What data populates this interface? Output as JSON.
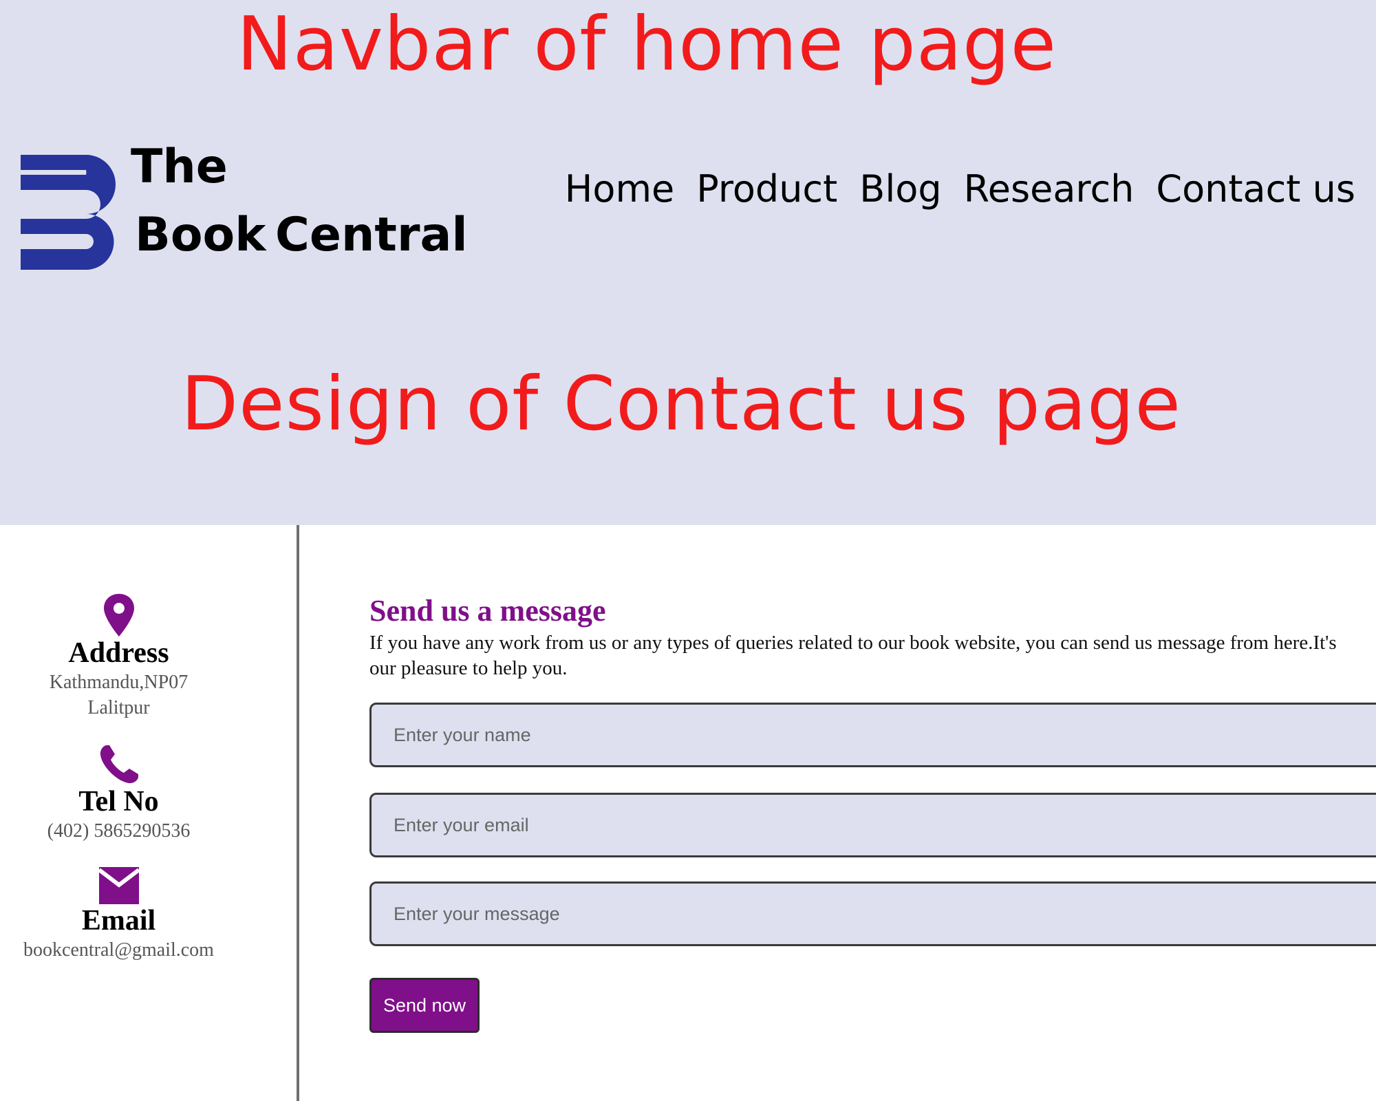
{
  "annotations": {
    "navbar_caption": "Navbar of home page",
    "contact_caption": "Design of Contact us page"
  },
  "brand": {
    "word_the": "The",
    "word_book": "Book",
    "word_central": "Central",
    "logo_color": "#26349b"
  },
  "nav": {
    "items": [
      {
        "label": "Home"
      },
      {
        "label": "Product"
      },
      {
        "label": "Blog"
      },
      {
        "label": "Research"
      },
      {
        "label": "Contact us"
      }
    ]
  },
  "contact_info": {
    "address": {
      "label": "Address",
      "line1": "Kathmandu,NP07",
      "line2": "Lalitpur",
      "icon": "map-pin-icon"
    },
    "tel": {
      "label": "Tel No",
      "value": "(402) 5865290536",
      "icon": "phone-icon"
    },
    "email": {
      "label": "Email",
      "value": "bookcentral@gmail.com",
      "icon": "envelope-icon"
    },
    "icon_color": "#800f8a"
  },
  "form": {
    "title": "Send us a message",
    "description": "If you have any work from us or any types of queries related to our book website, you can send us message from here.It's our pleasure to help you.",
    "name_placeholder": "Enter your name",
    "email_placeholder": "Enter your email",
    "message_placeholder": "Enter your message",
    "submit_label": "Send now",
    "accent_color": "#800f8a"
  }
}
